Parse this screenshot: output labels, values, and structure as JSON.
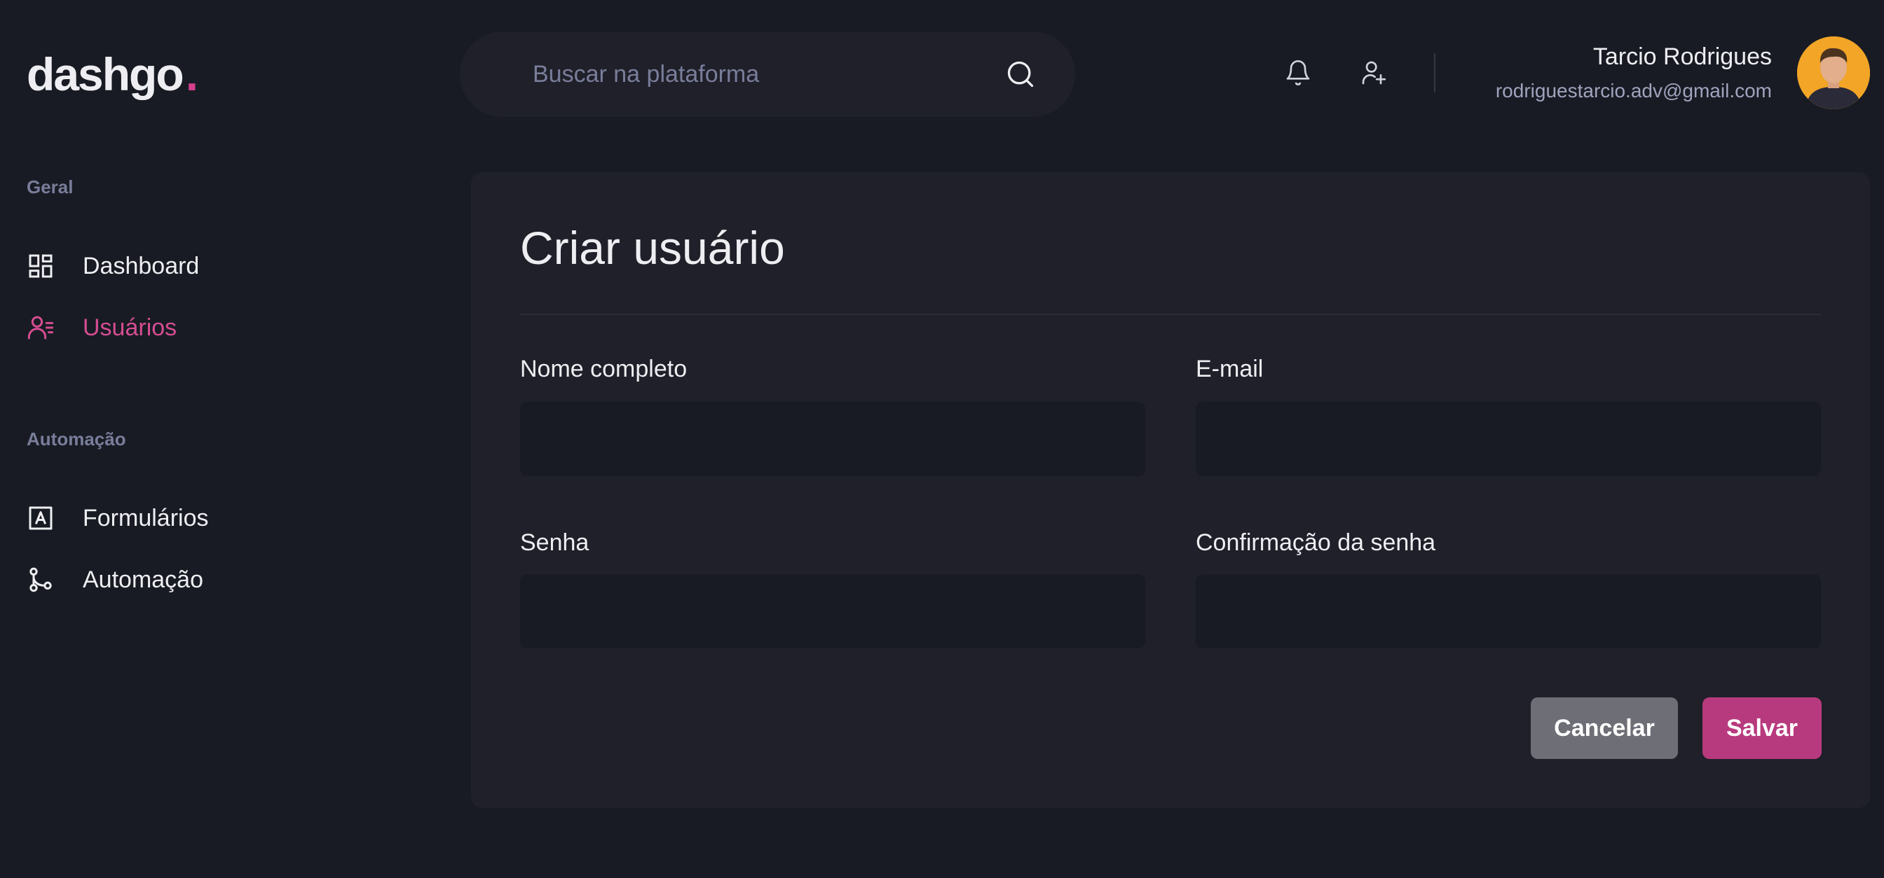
{
  "app": {
    "logo_text": "dashgo",
    "logo_dot": "."
  },
  "search": {
    "placeholder": "Buscar na plataforma"
  },
  "profile": {
    "name": "Tarcio Rodrigues",
    "email": "rodriguestarcio.adv@gmail.com"
  },
  "sidebar": {
    "sections": [
      {
        "title": "Geral",
        "items": [
          {
            "label": "Dashboard",
            "icon": "dashboard-icon"
          },
          {
            "label": "Usuários",
            "icon": "users-icon",
            "active": true
          }
        ]
      },
      {
        "title": "Automação",
        "items": [
          {
            "label": "Formulários",
            "icon": "form-icon"
          },
          {
            "label": "Automação",
            "icon": "git-branch-icon"
          }
        ]
      }
    ]
  },
  "form": {
    "title": "Criar usuário",
    "fields": {
      "name": {
        "label": "Nome completo",
        "value": ""
      },
      "email": {
        "label": "E-mail",
        "value": ""
      },
      "password": {
        "label": "Senha",
        "value": ""
      },
      "password_confirmation": {
        "label": "Confirmação da senha",
        "value": ""
      }
    },
    "cancel_label": "Cancelar",
    "save_label": "Salvar"
  },
  "colors": {
    "background": "#181b23",
    "surface": "#1f2029",
    "accent": "#d53f8c",
    "muted_text": "#797d9a",
    "cancel_button": "#6e6e76",
    "save_button": "#b83a7e"
  }
}
